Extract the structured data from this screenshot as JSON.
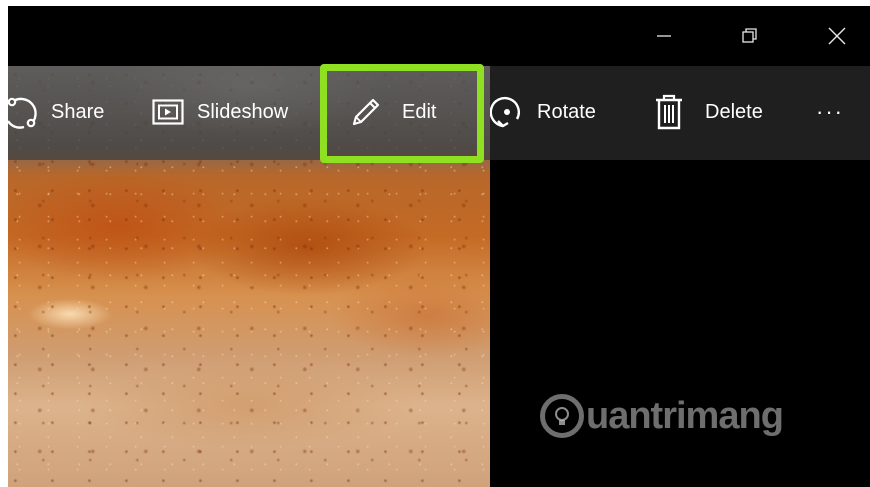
{
  "window": {
    "controls": {
      "minimize": "minimize-icon",
      "restore": "restore-icon",
      "close": "close-icon"
    }
  },
  "toolbar": {
    "items": [
      {
        "label": "Share",
        "icon": "share-icon"
      },
      {
        "label": "Slideshow",
        "icon": "slideshow-icon"
      },
      {
        "label": "Edit",
        "icon": "pencil-icon"
      },
      {
        "label": "Rotate",
        "icon": "rotate-icon"
      },
      {
        "label": "Delete",
        "icon": "trash-icon"
      }
    ],
    "more": "···"
  },
  "watermark": {
    "text": "uantrimang",
    "icon": "lightbulb-icon"
  },
  "colors": {
    "highlight": "#8fe021",
    "background": "#000000",
    "toolbar": "#1f1f1f"
  }
}
